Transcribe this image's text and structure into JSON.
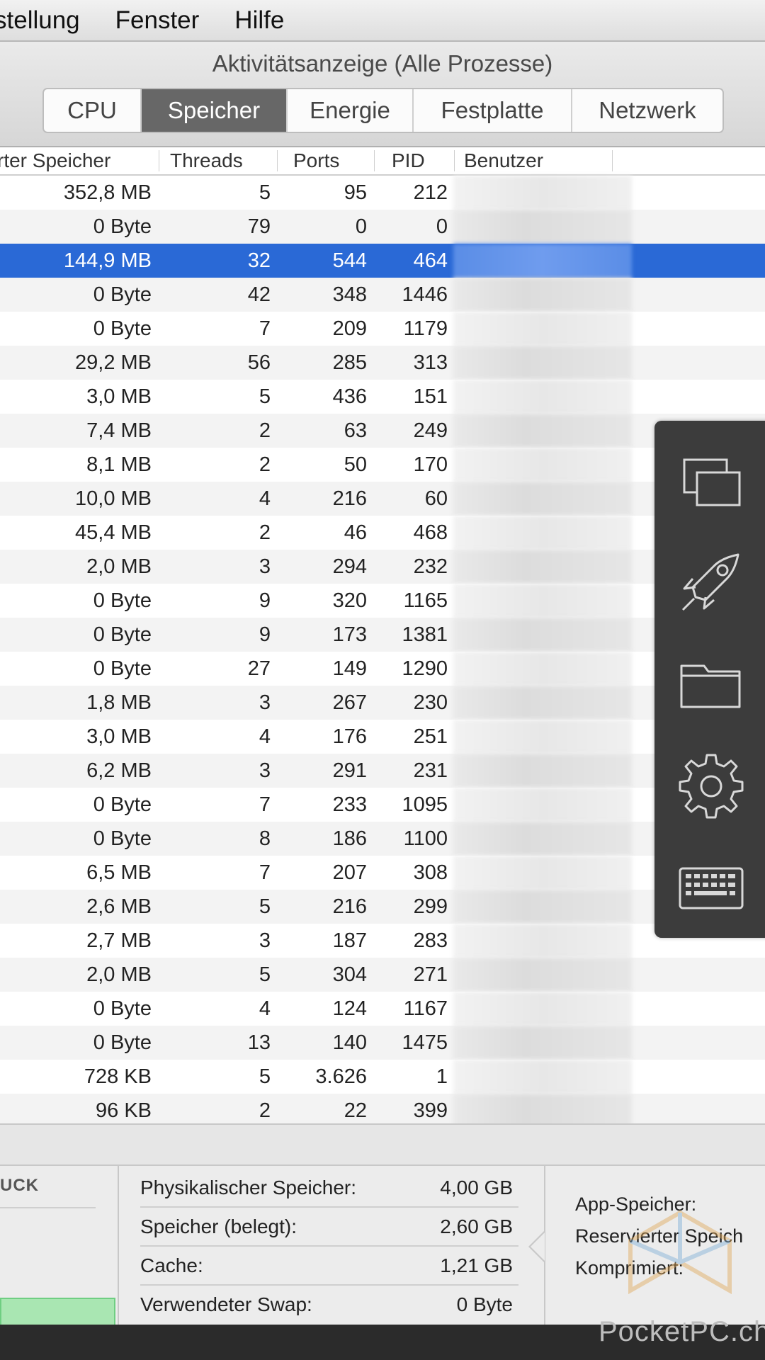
{
  "menubar": {
    "items": [
      "stellung",
      "Fenster",
      "Hilfe"
    ]
  },
  "window": {
    "title": "Aktivitätsanzeige (Alle Prozesse)"
  },
  "tabs": [
    {
      "label": "CPU",
      "active": false
    },
    {
      "label": "Speicher",
      "active": true
    },
    {
      "label": "Energie",
      "active": false
    },
    {
      "label": "Festplatte",
      "active": false
    },
    {
      "label": "Netzwerk",
      "active": false
    }
  ],
  "columns": {
    "memory": "rter Speicher",
    "threads": "Threads",
    "ports": "Ports",
    "pid": "PID",
    "user": "Benutzer"
  },
  "rows": [
    {
      "mem": "352,8 MB",
      "threads": "5",
      "ports": "95",
      "pid": "212"
    },
    {
      "mem": "0 Byte",
      "threads": "79",
      "ports": "0",
      "pid": "0"
    },
    {
      "mem": "144,9 MB",
      "threads": "32",
      "ports": "544",
      "pid": "464",
      "selected": true
    },
    {
      "mem": "0 Byte",
      "threads": "42",
      "ports": "348",
      "pid": "1446"
    },
    {
      "mem": "0 Byte",
      "threads": "7",
      "ports": "209",
      "pid": "1179"
    },
    {
      "mem": "29,2 MB",
      "threads": "56",
      "ports": "285",
      "pid": "313"
    },
    {
      "mem": "3,0 MB",
      "threads": "5",
      "ports": "436",
      "pid": "151"
    },
    {
      "mem": "7,4 MB",
      "threads": "2",
      "ports": "63",
      "pid": "249"
    },
    {
      "mem": "8,1 MB",
      "threads": "2",
      "ports": "50",
      "pid": "170"
    },
    {
      "mem": "10,0 MB",
      "threads": "4",
      "ports": "216",
      "pid": "60"
    },
    {
      "mem": "45,4 MB",
      "threads": "2",
      "ports": "46",
      "pid": "468"
    },
    {
      "mem": "2,0 MB",
      "threads": "3",
      "ports": "294",
      "pid": "232"
    },
    {
      "mem": "0 Byte",
      "threads": "9",
      "ports": "320",
      "pid": "1165"
    },
    {
      "mem": "0 Byte",
      "threads": "9",
      "ports": "173",
      "pid": "1381"
    },
    {
      "mem": "0 Byte",
      "threads": "27",
      "ports": "149",
      "pid": "1290"
    },
    {
      "mem": "1,8 MB",
      "threads": "3",
      "ports": "267",
      "pid": "230"
    },
    {
      "mem": "3,0 MB",
      "threads": "4",
      "ports": "176",
      "pid": "251"
    },
    {
      "mem": "6,2 MB",
      "threads": "3",
      "ports": "291",
      "pid": "231"
    },
    {
      "mem": "0 Byte",
      "threads": "7",
      "ports": "233",
      "pid": "1095"
    },
    {
      "mem": "0 Byte",
      "threads": "8",
      "ports": "186",
      "pid": "1100"
    },
    {
      "mem": "6,5 MB",
      "threads": "7",
      "ports": "207",
      "pid": "308"
    },
    {
      "mem": "2,6 MB",
      "threads": "5",
      "ports": "216",
      "pid": "299"
    },
    {
      "mem": "2,7 MB",
      "threads": "3",
      "ports": "187",
      "pid": "283"
    },
    {
      "mem": "2,0 MB",
      "threads": "5",
      "ports": "304",
      "pid": "271"
    },
    {
      "mem": "0 Byte",
      "threads": "4",
      "ports": "124",
      "pid": "1167"
    },
    {
      "mem": "0 Byte",
      "threads": "13",
      "ports": "140",
      "pid": "1475"
    },
    {
      "mem": "728 KB",
      "threads": "5",
      "ports": "3.626",
      "pid": "1"
    },
    {
      "mem": "96 KB",
      "threads": "2",
      "ports": "22",
      "pid": "399"
    }
  ],
  "pressure": {
    "title": "UCK"
  },
  "memory_summary": [
    {
      "label": "Physikalischer Speicher:",
      "value": "4,00 GB"
    },
    {
      "label": "Speicher (belegt):",
      "value": "2,60 GB"
    },
    {
      "label": "Cache:",
      "value": "1,21 GB"
    },
    {
      "label": "Verwendeter Swap:",
      "value": "0 Byte"
    }
  ],
  "app_memory": [
    "App-Speicher:",
    "Reservierter Speich",
    "Komprimiert:"
  ],
  "dock_icons": [
    "windows-icon",
    "rocket-icon",
    "folder-icon",
    "gear-icon",
    "keyboard-icon"
  ],
  "watermark": "PocketPC.ch",
  "colors": {
    "selection": "#2a69d6",
    "active_tab": "#676767",
    "pressure": "#a9e6b2"
  }
}
